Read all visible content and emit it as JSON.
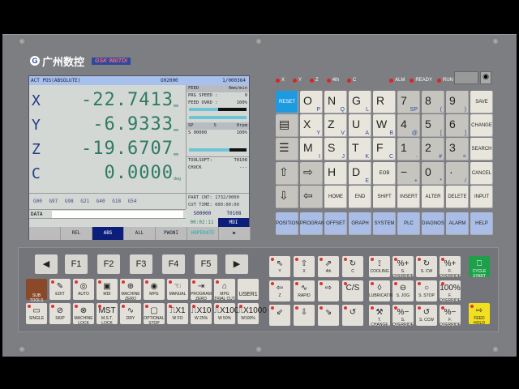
{
  "brand": {
    "name": "广州数控",
    "model": "GSK 980TDi"
  },
  "screen": {
    "title": "ACT POS(ABSOLUTE)",
    "program": "O02000",
    "block": "1/000364",
    "axes": [
      {
        "name": "X",
        "value": "-22.7413",
        "unit": "mm"
      },
      {
        "name": "Y",
        "value": "-6.9333",
        "unit": "mm"
      },
      {
        "name": "Z",
        "value": "-19.6707",
        "unit": "mm"
      },
      {
        "name": "C",
        "value": "0.0000",
        "unit": "deg"
      }
    ],
    "feed": {
      "label": "FEED",
      "unit": "0mm/min",
      "prg_speed_label": "PRG SPEED :",
      "prg_speed": "0",
      "ovrd_label": "FEED OVRD :",
      "ovrd": "100%",
      "ovrd_fraction": 0.5,
      "rapid_fraction": 1.0
    },
    "spindle": {
      "label": "SP",
      "s": "S",
      "rpm": "0rpm",
      "s_value": "S 00000",
      "s_ovrd": "100%",
      "fraction": 0.7
    },
    "tool_label": "TOOLSOFT:",
    "tool": "T0108",
    "chuck_label": "CHUCK",
    "chuck": "---",
    "gcodes": "G00 G97 G98 G21 G40 G18 G54",
    "part_cnt": "PART CNT: 1732/0000",
    "cut_time": "CUT TIME: 000:00:00",
    "s_cmd": "S00000",
    "t_cmd": "T0108",
    "clock": "00:02:11",
    "mode": "MDI",
    "data_label": "DATA",
    "data_value": "",
    "softkeys": [
      "",
      "REL",
      "ABS",
      "ALL",
      "PWONI",
      "HOPERATE",
      "▶"
    ],
    "active_softkey": 2
  },
  "indicators": {
    "axes": [
      "X",
      "Y",
      "Z",
      "4th",
      "C"
    ],
    "status": [
      "ALM",
      "READY",
      "RUN"
    ]
  },
  "keypad": [
    [
      {
        "m": "RESET",
        "t": "reset"
      },
      {
        "m": "O",
        "s": "P"
      },
      {
        "m": "N",
        "s": "Q"
      },
      {
        "m": "G",
        "s": "L"
      },
      {
        "m": "R"
      },
      {
        "m": "7",
        "s": "SP",
        "t": "num"
      },
      {
        "m": "8",
        "s": "(",
        "t": "num"
      },
      {
        "m": "9",
        "s": ")",
        "t": "num"
      },
      {
        "m": "SAVE",
        "w": 1
      }
    ],
    [
      {
        "m": "▤",
        "t": "dark"
      },
      {
        "m": "X",
        "s": "Y"
      },
      {
        "m": "Z",
        "s": "V"
      },
      {
        "m": "U",
        "s": "A"
      },
      {
        "m": "W",
        "s": "B"
      },
      {
        "m": "4",
        "s": "@",
        "t": "num"
      },
      {
        "m": "5",
        "s": "[",
        "t": "num"
      },
      {
        "m": "6",
        "s": "]",
        "t": "num"
      },
      {
        "m": "CHANGE",
        "w": 1
      }
    ],
    [
      {
        "m": "☰",
        "t": "dark"
      },
      {
        "m": "M",
        "s": "I"
      },
      {
        "m": "S",
        "s": "J"
      },
      {
        "m": "T",
        "s": "K"
      },
      {
        "m": "F",
        "s": "C"
      },
      {
        "m": "1",
        "s": "·",
        "t": "num"
      },
      {
        "m": "2",
        "s": "#",
        "t": "num"
      },
      {
        "m": "3",
        "s": "=",
        "t": "num"
      },
      {
        "m": "SEARCH",
        "w": 1
      }
    ],
    [
      {
        "m": "⇧",
        "t": "dark"
      },
      {
        "m": "⇨",
        "t": "dark"
      },
      {
        "m": "H"
      },
      {
        "m": "D",
        "s": "E"
      },
      {
        "m": "EOB",
        "w": 1
      },
      {
        "m": "−",
        "s": "+",
        "t": "num"
      },
      {
        "m": "0",
        "s": "*",
        "t": "num"
      },
      {
        "m": "·",
        "s": "/",
        "t": "num"
      },
      {
        "m": "CANCEL",
        "w": 1
      }
    ],
    [
      {
        "m": "⇩",
        "t": "dark"
      },
      {
        "m": "⇦",
        "t": "dark"
      },
      {
        "m": "HOME",
        "w": 1
      },
      {
        "m": "END",
        "w": 1
      },
      {
        "m": "SHIFT",
        "w": 1
      },
      {
        "m": "INSERT",
        "w": 1
      },
      {
        "m": "ALTER",
        "w": 1
      },
      {
        "m": "DELETE",
        "w": 1
      },
      {
        "m": "INPUT",
        "w": 1
      }
    ],
    [
      {
        "m": "POSITION",
        "w": 1,
        "t": "blue"
      },
      {
        "m": "PROGRAM",
        "w": 1,
        "t": "blue"
      },
      {
        "m": "OFFSET",
        "w": 1,
        "t": "blue"
      },
      {
        "m": "GRAPH",
        "w": 1,
        "t": "blue"
      },
      {
        "m": "SYSTEM",
        "w": 1,
        "t": "blue"
      },
      {
        "m": "PLC",
        "w": 1,
        "t": "blue"
      },
      {
        "m": "DIAGNOS",
        "w": 1,
        "t": "blue"
      },
      {
        "m": "ALARM",
        "w": 1,
        "t": "blue"
      },
      {
        "m": "HELP",
        "w": 1,
        "t": "blue"
      }
    ]
  ],
  "fkeys": [
    "◀",
    "F1",
    "F2",
    "F3",
    "F4",
    "F5",
    "▶"
  ],
  "ops_left": [
    [
      {
        "l": "SUB TOOLS",
        "g": ""
      },
      {
        "l": "EDIT",
        "g": "✎"
      },
      {
        "l": "AUTO",
        "g": "◎"
      },
      {
        "l": "MDI",
        "g": "▣"
      },
      {
        "l": "MACHINE ZERO",
        "g": "⊕"
      },
      {
        "l": "MPG",
        "g": "◉"
      },
      {
        "l": "MANUAL",
        "g": "☜"
      },
      {
        "l": "PROGRAM ZERO",
        "g": "⇥"
      },
      {
        "l": "MPG TRIAL CUT",
        "g": "⌂"
      },
      {
        "l": "USER1",
        "g": ""
      }
    ],
    [
      {
        "l": "SINGLE",
        "g": "▭"
      },
      {
        "l": "SKIP",
        "g": "⊘"
      },
      {
        "l": "MACHINE LOCK",
        "g": "⊗"
      },
      {
        "l": "M.S.T. LOCK",
        "g": "MST"
      },
      {
        "l": "DRY",
        "g": "∿"
      },
      {
        "l": "OPTIONAL STOP",
        "g": "▢"
      },
      {
        "l": "W FO",
        "g": "⎍X1"
      },
      {
        "l": "W 25%",
        "g": "⎍X10"
      },
      {
        "l": "W 50%",
        "g": "⎍X100"
      },
      {
        "l": "W100%",
        "g": "⎍X1000"
      }
    ]
  ],
  "ops_right": [
    [
      {
        "l": "Y",
        "g": "⇖"
      },
      {
        "l": "X",
        "g": "⇧"
      },
      {
        "l": "4th",
        "g": "⇗"
      },
      {
        "l": "C",
        "g": "↻"
      },
      {
        "l": "COOLING",
        "g": "⟟"
      },
      {
        "l": "S. OVERRIDE",
        "g": "%+"
      },
      {
        "l": "S. CW",
        "g": "↻"
      },
      {
        "l": "F. OVERRIDE",
        "g": "%+"
      }
    ],
    [
      {
        "l": "Z",
        "g": "⇦"
      },
      {
        "l": "RAPID",
        "g": "∿"
      },
      {
        "l": "",
        "g": "⇨"
      },
      {
        "l": "",
        "g": "C/S"
      },
      {
        "l": "LUBRICATING",
        "g": "◊"
      },
      {
        "l": "S. JOG",
        "g": "⊖"
      },
      {
        "l": "S. STOP",
        "g": "○"
      },
      {
        "l": "F. OVERRIDE",
        "g": "100%"
      }
    ],
    [
      {
        "l": "",
        "g": "⇙"
      },
      {
        "l": "",
        "g": "⇩"
      },
      {
        "l": "",
        "g": "⇘"
      },
      {
        "l": "",
        "g": "↺"
      },
      {
        "l": "T. CHANGE",
        "g": "⚒"
      },
      {
        "l": "S. OVERRIDE",
        "g": "%−"
      },
      {
        "l": "S. CCW",
        "g": "↺"
      },
      {
        "l": "F. OVERRIDE",
        "g": "%−"
      }
    ]
  ],
  "cycle_start": "CYCLE START",
  "feed_hold": "FEED HOLD"
}
